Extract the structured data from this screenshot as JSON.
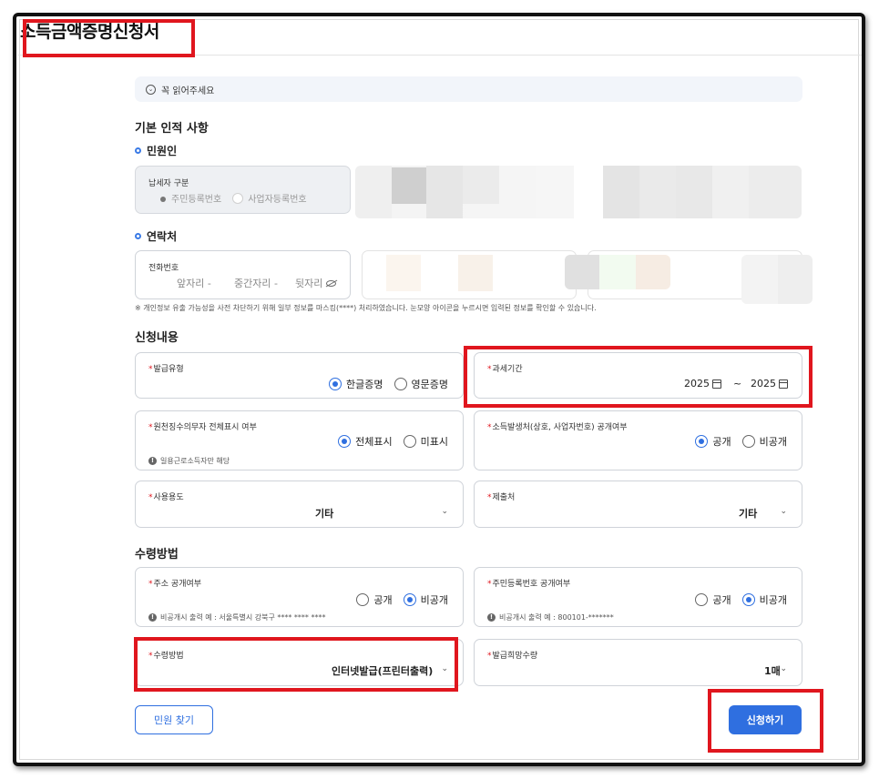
{
  "page_title": "소득금액증명신청서",
  "notice": {
    "label": "꼭 읽어주세요",
    "icon": "chevron-down-icon"
  },
  "basic": {
    "heading": "기본 인적 사항",
    "applicant_heading": "민원인",
    "taxpayer_type": {
      "label": "납세자 구분",
      "options": [
        {
          "label": "주민등록번호",
          "selected": true
        },
        {
          "label": "사업자등록번호",
          "selected": false
        }
      ]
    },
    "contact_heading": "연락처",
    "phone": {
      "label": "전화번호",
      "first": "앞자리",
      "middle": "중간자리",
      "last": "뒷자리",
      "sep": "-"
    },
    "privacy_note": "※ 개인정보 유출 가능성을 사전 차단하기 위해 일부 정보를 마스킹(****) 처리하였습니다. 눈모양 아이콘을 누르시면 입력된 정보를 확인할 수 있습니다."
  },
  "request": {
    "heading": "신청내용",
    "issue_type": {
      "label": "발급유형",
      "options": [
        {
          "label": "한글증명",
          "selected": true
        },
        {
          "label": "영문증명",
          "selected": false
        }
      ]
    },
    "tax_period": {
      "label": "과세기간",
      "from": "2025",
      "to": "2025",
      "sep": "~"
    },
    "withholding_display": {
      "label": "원천징수의무자 전체표시 여부",
      "options": [
        {
          "label": "전체표시",
          "selected": true
        },
        {
          "label": "미표시",
          "selected": false
        }
      ],
      "hint": "일용근로소득자만 해당"
    },
    "income_source_disclosure": {
      "label": "소득발생처(상호, 사업자번호) 공개여부",
      "options": [
        {
          "label": "공개",
          "selected": true
        },
        {
          "label": "비공개",
          "selected": false
        }
      ]
    },
    "purpose": {
      "label": "사용용도",
      "value": "기타"
    },
    "submit_to": {
      "label": "제출처",
      "value": "기타"
    }
  },
  "receive": {
    "heading": "수령방법",
    "address_disclosure": {
      "label": "주소 공개여부",
      "options": [
        {
          "label": "공개",
          "selected": false
        },
        {
          "label": "비공개",
          "selected": true
        }
      ],
      "hint": "비공개시 출력 예 : 서울특별시 강북구 **** **** ****"
    },
    "rrn_disclosure": {
      "label": "주민등록번호 공개여부",
      "options": [
        {
          "label": "공개",
          "selected": false
        },
        {
          "label": "비공개",
          "selected": true
        }
      ],
      "hint": "비공개시 출력 예 : 800101-*******"
    },
    "method": {
      "label": "수령방법",
      "value": "인터넷발급(프린터출력)"
    },
    "copies": {
      "label": "발급희망수량",
      "value": "1매"
    }
  },
  "actions": {
    "find_label": "민원 찾기",
    "submit_label": "신청하기"
  },
  "required_mark": "*",
  "info_mark": "!",
  "colors": {
    "accent": "#2f6fe0",
    "highlight": "#e0161e",
    "required": "#e0161e"
  }
}
